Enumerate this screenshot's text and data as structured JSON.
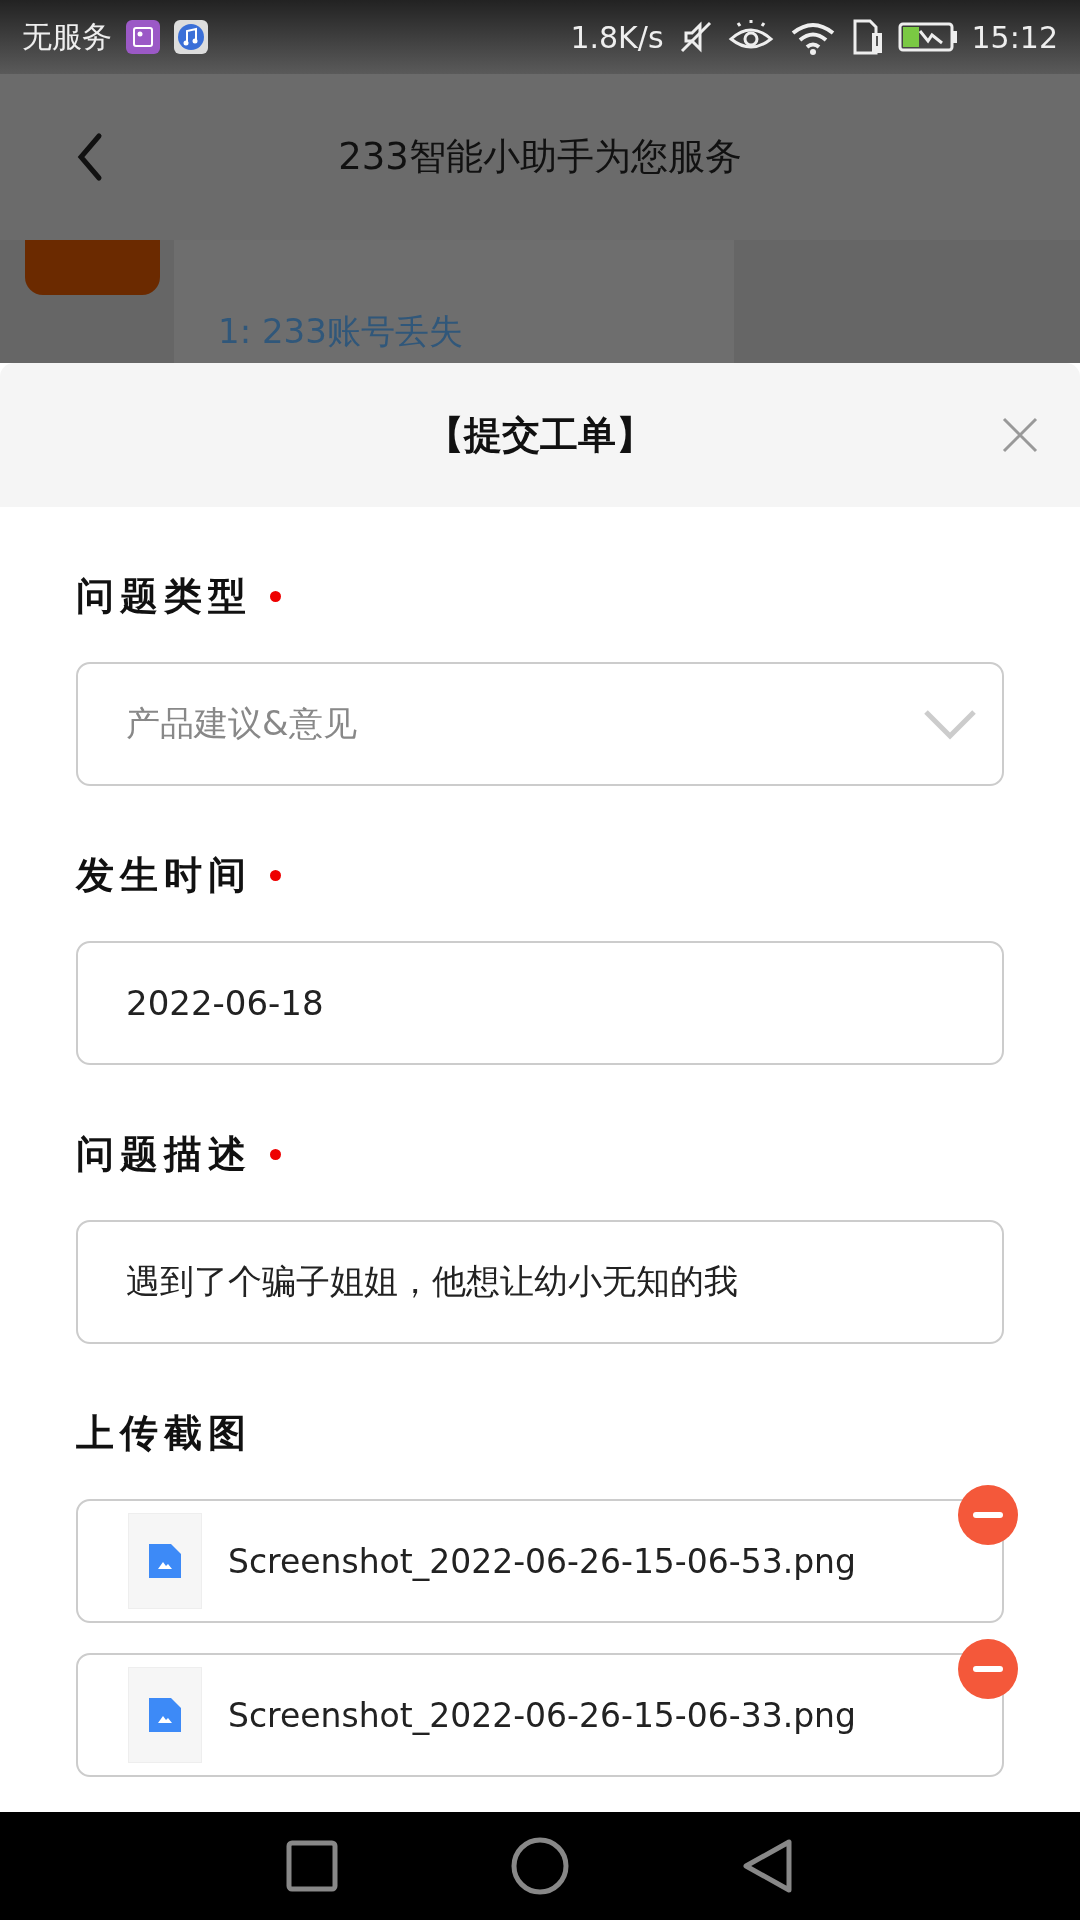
{
  "status_bar": {
    "carrier": "无服务",
    "net_speed": "1.8K/s",
    "time": "15:12"
  },
  "header": {
    "title": "233智能小助手为您服务"
  },
  "chat": {
    "link": "1: 233账号丢失"
  },
  "sheet": {
    "title": "【提交工单】",
    "fields": [
      {
        "kind": "select",
        "label": "问题类型",
        "required": true,
        "value": "产品建议&意见"
      },
      {
        "kind": "text",
        "label": "发生时间",
        "required": true,
        "value": "2022-06-18"
      },
      {
        "kind": "text",
        "label": "问题描述",
        "required": true,
        "value": "遇到了个骗子姐姐，他想让幼小无知的我"
      },
      {
        "kind": "upload",
        "label": "上传截图",
        "required": false,
        "files": [
          {
            "name": "Screenshot_2022-06-26-15-06-53.png"
          },
          {
            "name": "Screenshot_2022-06-26-15-06-33.png"
          }
        ]
      }
    ]
  }
}
